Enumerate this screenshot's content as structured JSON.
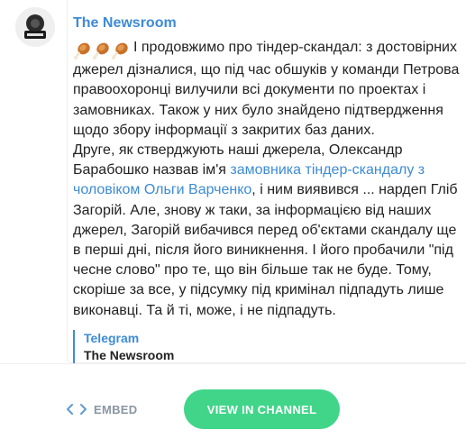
{
  "channel": {
    "name": "The Newsroom",
    "avatar_icon": "channel-logo"
  },
  "message": {
    "emoji": "drumstick-icon",
    "emoji_count": 3,
    "paragraph1": "І продовжимо про тіндер-скандал: з достовірних джерел дізналися, що під час обшуків у команди Петрова правоохоронці вилучили всі документи по проектах і замовниках. Також у них було знайдено підтвердження щодо збору інформації з закритих баз даних.",
    "p2_before_link": "Друге, як стверджують наші джерела, Олександр Барабошко назвав ім'я ",
    "p2_link": "замовника тіндер-скандалу з чоловіком Ольги Варченко",
    "p2_after_link": ", і ним виявився ... нардеп Гліб Загорій. Але, знову ж таки, за інформацією від наших джерел, Загорій вибачився перед об'єктами скандалу ще в перші дні, після його виникнення. І його пробачили \"під чесне слово\" про те, що він більше так не буде. Тому, скоріше за все, у підсумку під кримінал підпадуть лише виконавці. Та й ті, може, і не підпадуть."
  },
  "preview": {
    "site": "Telegram",
    "title": "The Newsroom"
  },
  "footer": {
    "embed_icon": "code-icon",
    "embed_label": "EMBED",
    "view_label": "VIEW IN CHANNEL"
  },
  "colors": {
    "accent": "#3d8bd6",
    "button": "#41d58a",
    "text": "#222222",
    "muted": "#8a96a3"
  }
}
